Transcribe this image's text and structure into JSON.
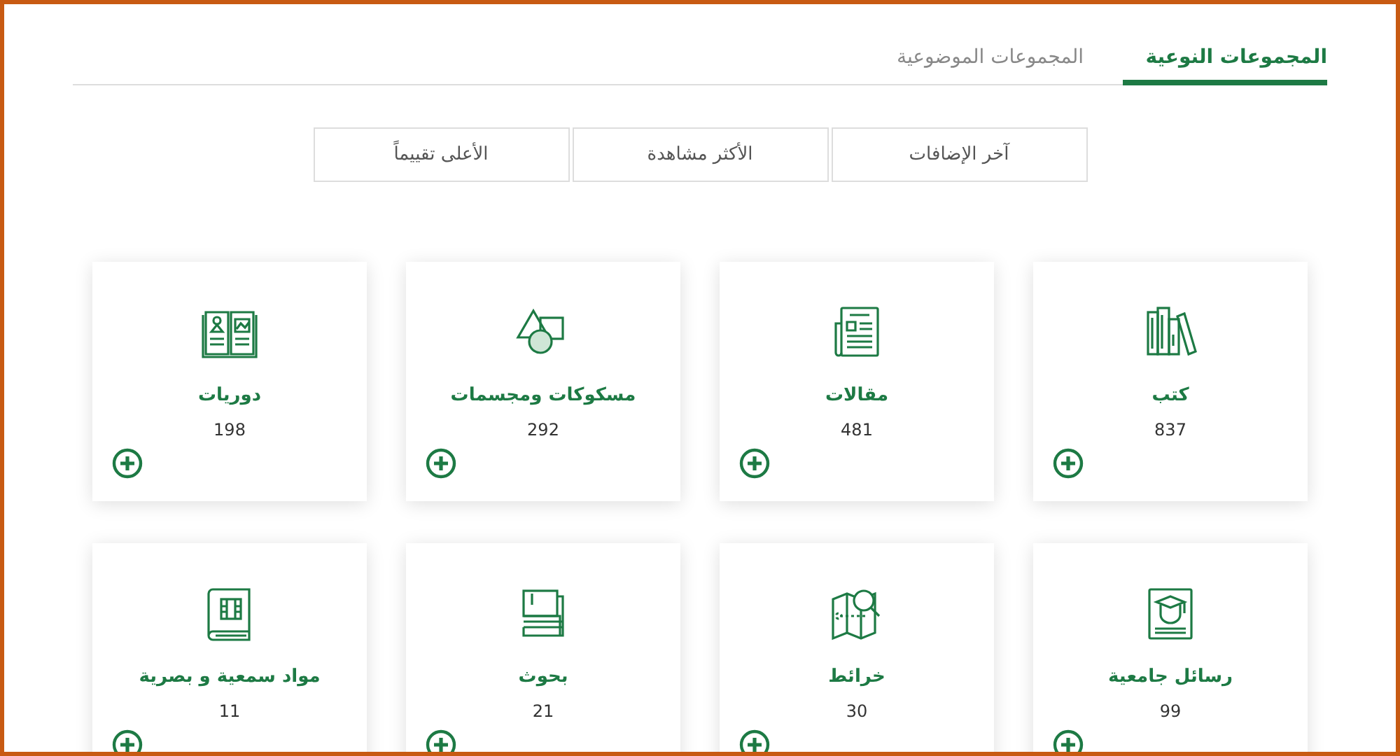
{
  "tabs": [
    {
      "label": "المجموعات النوعية",
      "selected": true
    },
    {
      "label": "المجموعات الموضوعية",
      "selected": false
    }
  ],
  "sort_buttons": [
    "آخر الإضافات",
    "الأكثر مشاهدة",
    "الأعلى تقييماً"
  ],
  "collections": [
    {
      "title": "كتب",
      "count": "837"
    },
    {
      "title": "مقالات",
      "count": "481"
    },
    {
      "title": "مسكوكات ومجسمات",
      "count": "292"
    },
    {
      "title": "دوريات",
      "count": "198"
    },
    {
      "title": "رسائل جامعية",
      "count": "99"
    },
    {
      "title": "خرائط",
      "count": "30"
    },
    {
      "title": "بحوث",
      "count": "21"
    },
    {
      "title": "مواد سمعية و بصرية",
      "count": "11"
    }
  ]
}
